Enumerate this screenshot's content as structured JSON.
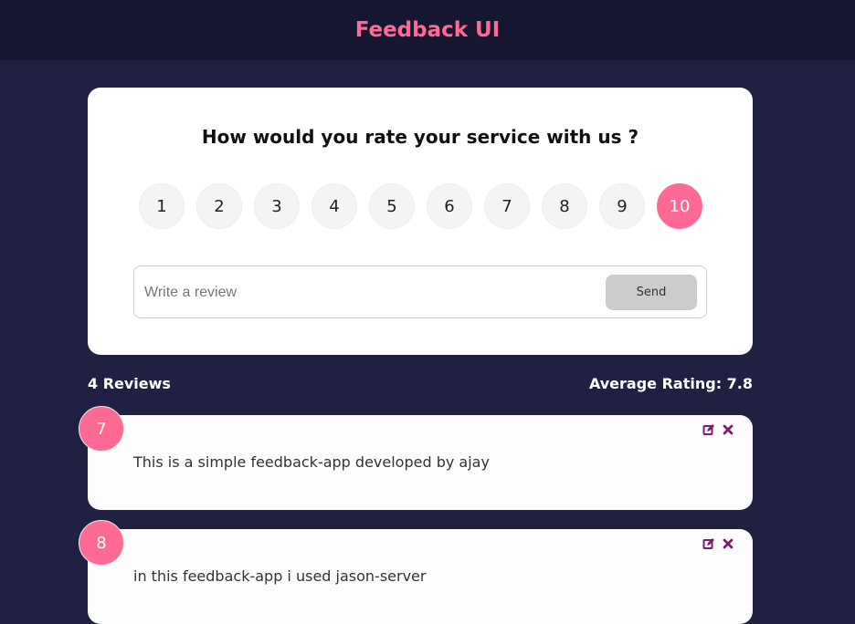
{
  "header": {
    "title": "Feedback UI"
  },
  "rating_card": {
    "question": "How would you rate your service with us ?",
    "ratings": [
      "1",
      "2",
      "3",
      "4",
      "5",
      "6",
      "7",
      "8",
      "9",
      "10"
    ],
    "selected_rating": "10",
    "review_input": {
      "value": "",
      "placeholder": "Write a review"
    },
    "send_label": "Send"
  },
  "stats": {
    "reviews_label": "4 Reviews",
    "average_label": "Average Rating: 7.8"
  },
  "reviews": [
    {
      "rating": "7",
      "text": "This is a simple feedback-app developed by ajay"
    },
    {
      "rating": "8",
      "text": "in this feedback-app i used jason-server"
    }
  ],
  "colors": {
    "accent": "#ff6a95",
    "background": "#202142",
    "header": "#151630",
    "icon": "#7f1c6e"
  },
  "icons": [
    "edit-icon",
    "close-icon"
  ]
}
